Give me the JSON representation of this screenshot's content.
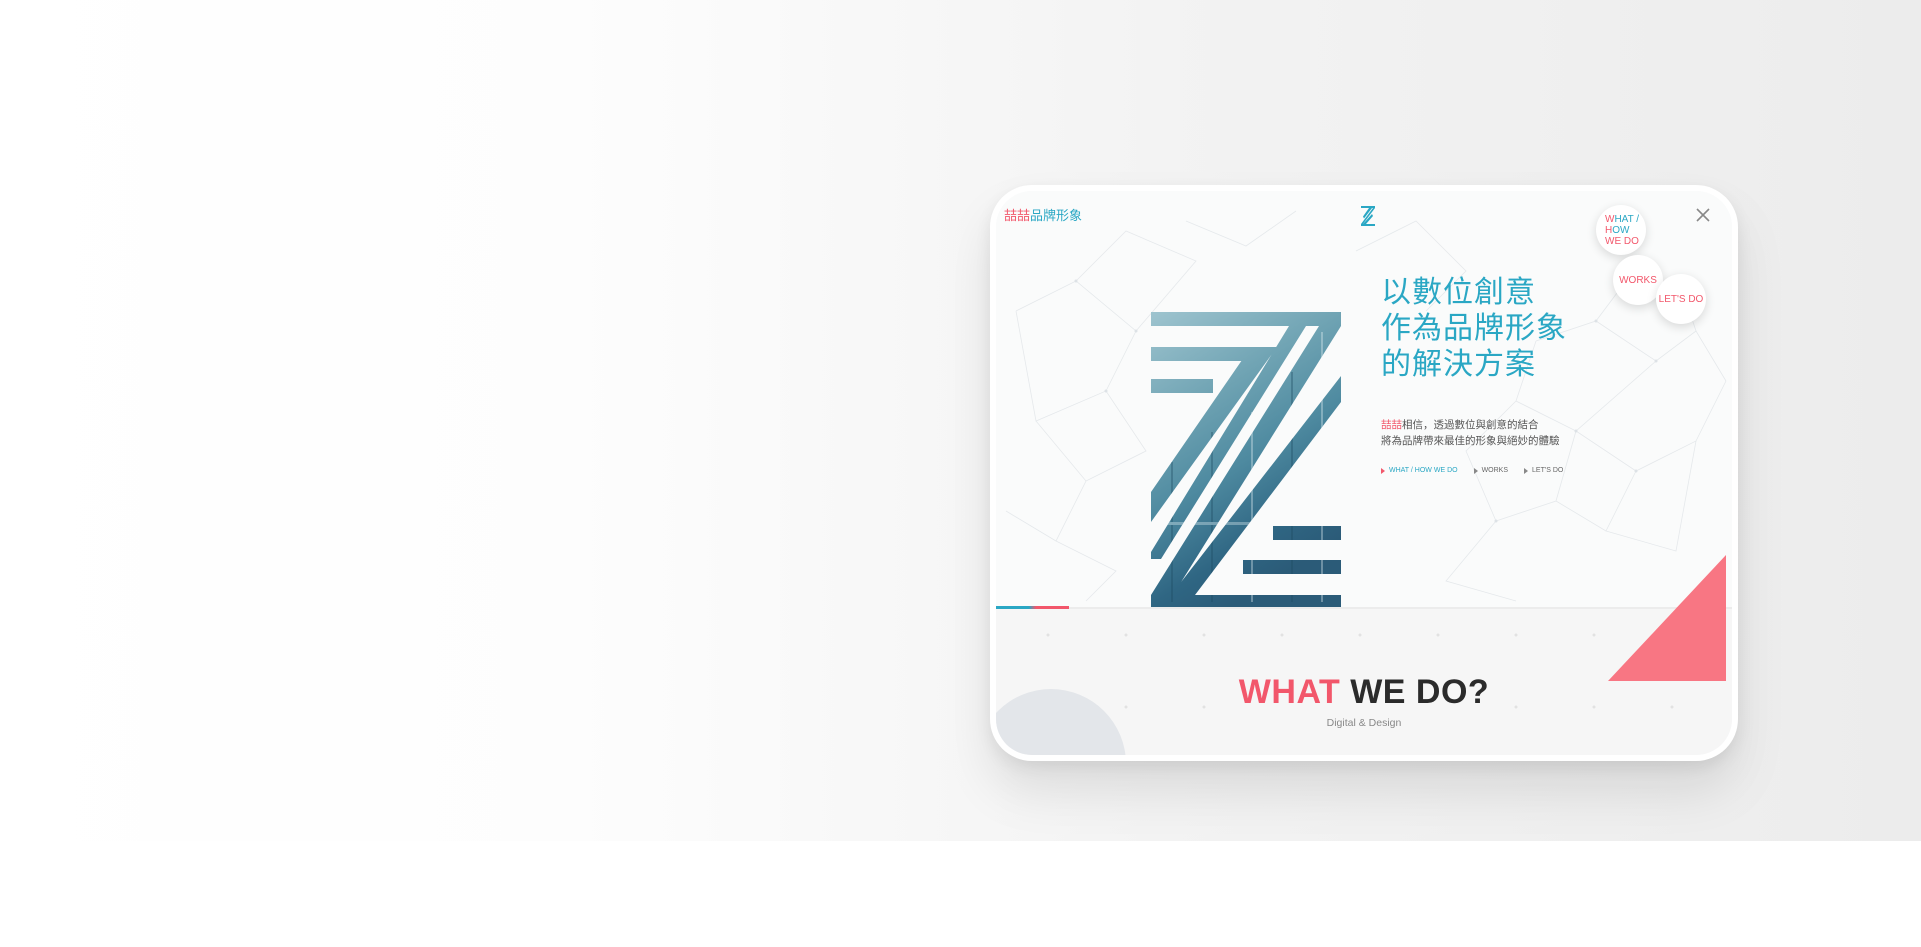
{
  "brand": {
    "name_highlight": "喆喆",
    "name_rest": "品牌形象"
  },
  "top_logo": {
    "icon": "z-logo-icon"
  },
  "close": {
    "icon": "close-icon"
  },
  "floating_nav": {
    "what_line1_pink": "W",
    "what_line1_blue": "HAT /",
    "what_line2_pink": "H",
    "what_line2_blue": "OW",
    "what_line3": "WE DO",
    "works": "WORKS",
    "lets": "LET'S DO"
  },
  "hero": {
    "headline": [
      "以數位創意",
      "作為品牌形象",
      "的解決方案"
    ],
    "desc_highlight": "喆喆",
    "desc_line1_rest": "相信，透過數位與創意的結合",
    "desc_line2": "將為品牌帶來最佳的形象與絕妙的體驗",
    "mini_nav": [
      "WHAT / HOW  WE DO",
      "WORKS",
      "LET'S DO"
    ]
  },
  "section": {
    "title_highlight": "WHAT",
    "title_rest": " WE DO?",
    "subtitle": "Digital & Design"
  },
  "colors": {
    "accent_blue": "#2aa7c4",
    "accent_pink": "#f2576b",
    "triangle": "#f87683"
  }
}
